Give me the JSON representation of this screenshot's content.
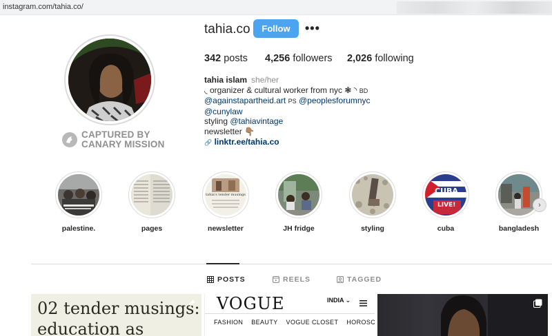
{
  "browser": {
    "url": "instagram.com/tahia.co/"
  },
  "profile": {
    "username": "tahia.co",
    "follow_label": "Follow",
    "more_label": "•••",
    "stats": {
      "posts_count": "342",
      "posts_label": "posts",
      "followers_count": "4,256",
      "followers_label": "followers",
      "following_count": "2,026",
      "following_label": "following"
    },
    "bio": {
      "full_name": "tahia islam",
      "pronouns": "she/her",
      "line1": "◟ organizer & cultural worker from nyc ❃ ◝",
      "line1_suffix": "BD",
      "mention1": "@againstapartheid.art",
      "mention1_sep": "PS",
      "mention2": "@peoplesforumnyc",
      "mention3": "@cunylaw",
      "styling_prefix": "styling",
      "styling_mention": "@tahiavintage",
      "newsletter": "newsletter 👇🏽",
      "link_icon": "🔗",
      "link": "linktr.ee/tahia.co"
    }
  },
  "watermark": {
    "line1": "CAPTURED BY",
    "line2": "CANARY MISSION",
    "icon": "canary-bird-icon"
  },
  "highlights": [
    {
      "label": "palestine."
    },
    {
      "label": "pages"
    },
    {
      "label": "newsletter"
    },
    {
      "label": "JH fridge"
    },
    {
      "label": "styling"
    },
    {
      "label": "cuba"
    },
    {
      "label": "bangladesh"
    }
  ],
  "highlight_thumbs": {
    "newsletter_title": "tahia's tender musings",
    "cuba_text1": "CUBA",
    "cuba_text2": "LIVE!"
  },
  "highlights_next_icon": "›",
  "tabs": [
    {
      "label": "POSTS",
      "icon": "grid-icon",
      "active": true
    },
    {
      "label": "REELS",
      "icon": "reels-icon",
      "active": false
    },
    {
      "label": "TAGGED",
      "icon": "tagged-icon",
      "active": false
    }
  ],
  "posts": {
    "post1_line1": "02 tender musings:",
    "post1_line2": "education as",
    "post2_logo": "VOGUE",
    "post2_region": "INDIA ⌄",
    "post2_nav": [
      "FASHION",
      "BEAUTY",
      "VOGUE CLOSET",
      "HOROSCOPE"
    ]
  },
  "colors": {
    "accent": "#4ca3f0",
    "link": "#00376b",
    "muted": "#8e8e8e"
  }
}
